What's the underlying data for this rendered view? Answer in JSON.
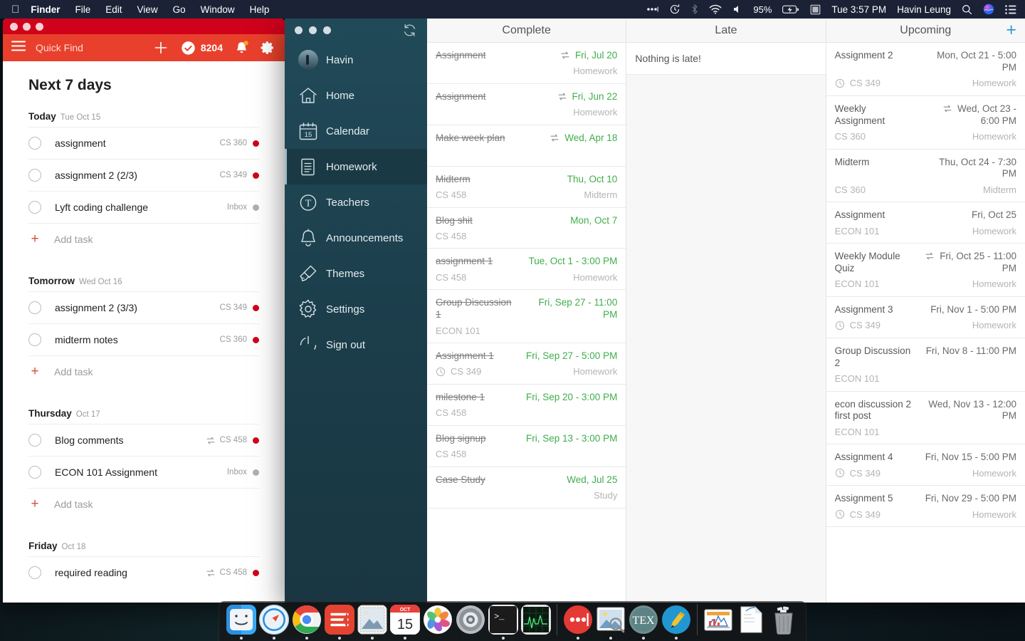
{
  "menubar": {
    "apple_icon": "apple-logo-icon",
    "items": [
      "Finder",
      "File",
      "Edit",
      "View",
      "Go",
      "Window",
      "Help"
    ],
    "status_icons": [
      "dots-icon",
      "time-machine-icon",
      "bluetooth-icon",
      "wifi-icon",
      "volume-icon"
    ],
    "battery_percent": "95%",
    "battery_icon": "battery-charging-icon",
    "keyboard_icon": "input-source-icon",
    "clock": "Tue 3:57 PM",
    "user": "Havin Leung",
    "search_icon": "spotlight-search-icon",
    "siri_icon": "siri-icon",
    "control_center_icon": "notification-center-icon"
  },
  "todoist": {
    "window_controls": [
      "close",
      "minimize",
      "maximize"
    ],
    "menu_icon": "hamburger-menu-icon",
    "quick_find_placeholder": "Quick Find",
    "add_icon": "plus-icon",
    "karma_icon": "check-circle-icon",
    "karma_points": "8204",
    "notifications_icon": "bell-icon",
    "settings_icon": "gear-icon",
    "view_title": "Next 7 days",
    "add_task_label": "Add task",
    "groups": [
      {
        "name": "Today",
        "date": "Tue Oct 15",
        "tasks": [
          {
            "title": "assignment",
            "project": "CS 360",
            "dot": "#d0021b",
            "recurring": false
          },
          {
            "title": "assignment 2 (2/3)",
            "project": "CS 349",
            "dot": "#d0021b",
            "recurring": false
          },
          {
            "title": "Lyft coding challenge",
            "project": "Inbox",
            "dot": "#b0b0b0",
            "recurring": false
          }
        ]
      },
      {
        "name": "Tomorrow",
        "date": "Wed Oct 16",
        "tasks": [
          {
            "title": "assignment 2 (3/3)",
            "project": "CS 349",
            "dot": "#d0021b",
            "recurring": false
          },
          {
            "title": "midterm notes",
            "project": "CS 360",
            "dot": "#d0021b",
            "recurring": false
          }
        ]
      },
      {
        "name": "Thursday",
        "date": "Oct 17",
        "tasks": [
          {
            "title": "Blog comments",
            "project": "CS 458",
            "dot": "#d0021b",
            "recurring": true
          },
          {
            "title": "ECON 101 Assignment",
            "project": "Inbox",
            "dot": "#b0b0b0",
            "recurring": false
          }
        ]
      },
      {
        "name": "Friday",
        "date": "Oct 18",
        "tasks": [
          {
            "title": "required reading",
            "project": "CS 458",
            "dot": "#d0021b",
            "recurring": true
          }
        ]
      }
    ]
  },
  "planner": {
    "window_controls": [
      "close",
      "minimize",
      "maximize"
    ],
    "sync_icon": "refresh-sync-icon",
    "sidebar": [
      {
        "label": "Havin",
        "icon": "user-avatar-icon",
        "active": false
      },
      {
        "label": "Home",
        "icon": "home-icon",
        "active": false
      },
      {
        "label": "Calendar",
        "icon": "calendar-icon",
        "active": false
      },
      {
        "label": "Homework",
        "icon": "document-icon",
        "active": true
      },
      {
        "label": "Teachers",
        "icon": "teacher-circle-t-icon",
        "active": false
      },
      {
        "label": "Announcements",
        "icon": "bell-icon",
        "active": false
      },
      {
        "label": "Themes",
        "icon": "paintbrush-icon",
        "active": false
      },
      {
        "label": "Settings",
        "icon": "gear-icon",
        "active": false
      },
      {
        "label": "Sign out",
        "icon": "power-icon",
        "active": false
      }
    ],
    "calendar_icon_day": "15",
    "columns": [
      {
        "title": "Complete",
        "has_add": false,
        "empty_text": "",
        "items": [
          {
            "name": "Assignment",
            "date": "Fri, Jul 20",
            "course": "",
            "type": "Homework",
            "recurring": true,
            "clock": false,
            "done": true
          },
          {
            "name": "Assignment",
            "date": "Fri, Jun 22",
            "course": "",
            "type": "Homework",
            "recurring": true,
            "clock": false,
            "done": true
          },
          {
            "name": "Make week plan",
            "date": "Wed, Apr 18",
            "course": "",
            "type": "",
            "recurring": true,
            "clock": false,
            "done": true
          },
          {
            "name": "Midterm",
            "date": "Thu, Oct 10",
            "course": "CS 458",
            "type": "Midterm",
            "recurring": false,
            "clock": false,
            "done": true
          },
          {
            "name": "Blog shit",
            "date": "Mon, Oct 7",
            "course": "CS 458",
            "type": "",
            "recurring": false,
            "clock": false,
            "done": true
          },
          {
            "name": "assignment 1",
            "date": "Tue, Oct 1 - 3:00 PM",
            "course": "CS 458",
            "type": "Homework",
            "recurring": false,
            "clock": false,
            "done": true
          },
          {
            "name": "Group Discussion 1",
            "date": "Fri, Sep 27 - 11:00 PM",
            "course": "ECON 101",
            "type": "",
            "recurring": false,
            "clock": false,
            "done": true
          },
          {
            "name": "Assignment 1",
            "date": "Fri, Sep 27 - 5:00 PM",
            "course": "CS 349",
            "type": "Homework",
            "recurring": false,
            "clock": true,
            "done": true
          },
          {
            "name": "milestone 1",
            "date": "Fri, Sep 20 - 3:00 PM",
            "course": "CS 458",
            "type": "",
            "recurring": false,
            "clock": false,
            "done": true
          },
          {
            "name": "Blog signup",
            "date": "Fri, Sep 13 - 3:00 PM",
            "course": "CS 458",
            "type": "",
            "recurring": false,
            "clock": false,
            "done": true
          },
          {
            "name": "Case Study",
            "date": "Wed, Jul 25",
            "course": "",
            "type": "Study",
            "recurring": false,
            "clock": false,
            "done": true
          }
        ]
      },
      {
        "title": "Late",
        "has_add": false,
        "empty_text": "Nothing is late!",
        "items": []
      },
      {
        "title": "Upcoming",
        "has_add": true,
        "add_icon": "plus-icon",
        "empty_text": "",
        "items": [
          {
            "name": "Assignment 2",
            "date": "Mon, Oct 21 - 5:00 PM",
            "course": "CS 349",
            "type": "Homework",
            "recurring": false,
            "clock": true,
            "done": false
          },
          {
            "name": "Weekly Assignment",
            "date": "Wed, Oct 23 - 6:00 PM",
            "course": "CS 360",
            "type": "Homework",
            "recurring": true,
            "clock": false,
            "done": false
          },
          {
            "name": "Midterm",
            "date": "Thu, Oct 24 - 7:30 PM",
            "course": "CS 360",
            "type": "Midterm",
            "recurring": false,
            "clock": false,
            "done": false
          },
          {
            "name": "Assignment",
            "date": "Fri, Oct 25",
            "course": "ECON 101",
            "type": "Homework",
            "recurring": false,
            "clock": false,
            "done": false
          },
          {
            "name": "Weekly Module Quiz",
            "date": "Fri, Oct 25 - 11:00 PM",
            "course": "ECON 101",
            "type": "Homework",
            "recurring": true,
            "clock": false,
            "done": false
          },
          {
            "name": "Assignment 3",
            "date": "Fri, Nov 1 - 5:00 PM",
            "course": "CS 349",
            "type": "Homework",
            "recurring": false,
            "clock": true,
            "done": false
          },
          {
            "name": "Group Discussion 2",
            "date": "Fri, Nov 8 - 11:00 PM",
            "course": "ECON 101",
            "type": "",
            "recurring": false,
            "clock": false,
            "done": false
          },
          {
            "name": "econ discussion 2 first post",
            "date": "Wed, Nov 13 - 12:00 PM",
            "course": "ECON 101",
            "type": "",
            "recurring": false,
            "clock": false,
            "done": false
          },
          {
            "name": "Assignment 4",
            "date": "Fri, Nov 15 - 5:00 PM",
            "course": "CS 349",
            "type": "Homework",
            "recurring": false,
            "clock": true,
            "done": false
          },
          {
            "name": "Assignment 5",
            "date": "Fri, Nov 29 - 5:00 PM",
            "course": "CS 349",
            "type": "Homework",
            "recurring": false,
            "clock": true,
            "done": false
          }
        ]
      }
    ]
  },
  "dock": {
    "items": [
      {
        "name": "finder",
        "running": true
      },
      {
        "name": "safari",
        "running": true
      },
      {
        "name": "chrome",
        "running": true
      },
      {
        "name": "todoist",
        "running": true
      },
      {
        "name": "mail",
        "running": true
      },
      {
        "name": "calendar",
        "running": true,
        "label": "OCT",
        "day": "15"
      },
      {
        "name": "photos",
        "running": false
      },
      {
        "name": "system-preferences",
        "running": false
      },
      {
        "name": "terminal",
        "running": true
      },
      {
        "name": "activity-monitor",
        "running": false
      },
      {
        "name": "separator"
      },
      {
        "name": "anki",
        "running": true
      },
      {
        "name": "preview",
        "running": true
      },
      {
        "name": "tex",
        "running": true,
        "label": "TeX"
      },
      {
        "name": "typora",
        "running": true
      },
      {
        "name": "separator2"
      },
      {
        "name": "documents-stack",
        "running": false
      },
      {
        "name": "downloads-stack",
        "running": false
      },
      {
        "name": "trash",
        "running": false
      }
    ]
  },
  "colors": {
    "todoist_red": "#e8402c",
    "todoist_titlebar": "#d0021b",
    "planner_sidebar": "#1d4351",
    "complete_green": "#3fae4a",
    "accent_blue": "#2f9bd6",
    "menubar": "#1b2236"
  }
}
